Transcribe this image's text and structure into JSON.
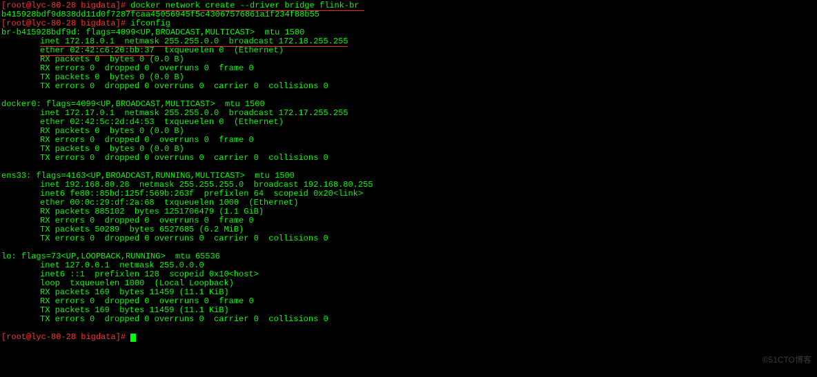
{
  "prompt1": {
    "user_host": "[root@lyc-80-28 bigdata]",
    "hash": "#",
    "cmd": " docker network create --driver bridge flink-br "
  },
  "network_id": "b415928bdf9d838dd11d0f7287fcaa45056945f5c43067576861a1f234f88b55",
  "prompt2": {
    "user_host": "[root@lyc-80-28 bigdata]",
    "hash": "#",
    "cmd": " ifconfig"
  },
  "br": {
    "l1": "br-b415928bdf9d: flags=4099<UP,BROADCAST,MULTICAST>  mtu 1500",
    "l2a": "inet 172.18.0.1  netmask 255.255.0.0  broadcast 172.18.255.255",
    "l3a": "ether 02:42:c6:20:bb:37",
    "l3b": "  txqueuelen 0  (Ethernet)",
    "l4": "RX packets 0  bytes 0 (0.0 B)",
    "l5": "RX errors 0  dropped 0  overruns 0  frame 0",
    "l6": "TX packets 0  bytes 0 (0.0 B)",
    "l7": "TX errors 0  dropped 0 overruns 0  carrier 0  collisions 0"
  },
  "docker0": {
    "l1": "docker0: flags=4099<UP,BROADCAST,MULTICAST>  mtu 1500",
    "l2": "inet 172.17.0.1  netmask 255.255.0.0  broadcast 172.17.255.255",
    "l3": "ether 02:42:5c:2d:d4:53  txqueuelen 0  (Ethernet)",
    "l4": "RX packets 0  bytes 0 (0.0 B)",
    "l5": "RX errors 0  dropped 0  overruns 0  frame 0",
    "l6": "TX packets 0  bytes 0 (0.0 B)",
    "l7": "TX errors 0  dropped 0 overruns 0  carrier 0  collisions 0"
  },
  "ens33": {
    "l1": "ens33: flags=4163<UP,BROADCAST,RUNNING,MULTICAST>  mtu 1500",
    "l2": "inet 192.168.80.28  netmask 255.255.255.0  broadcast 192.168.80.255",
    "l3": "inet6 fe80::85bd:125f:569b:263f  prefixlen 64  scopeid 0x20<link>",
    "l4": "ether 00:0c:29:df:2a:68  txqueuelen 1000  (Ethernet)",
    "l5": "RX packets 885102  bytes 1251706479 (1.1 GiB)",
    "l6": "RX errors 0  dropped 0  overruns 0  frame 0",
    "l7": "TX packets 50289  bytes 6527685 (6.2 MiB)",
    "l8": "TX errors 0  dropped 0 overruns 0  carrier 0  collisions 0"
  },
  "lo": {
    "l1": "lo: flags=73<UP,LOOPBACK,RUNNING>  mtu 65536",
    "l2": "inet 127.0.0.1  netmask 255.0.0.0",
    "l3": "inet6 ::1  prefixlen 128  scopeid 0x10<host>",
    "l4": "loop  txqueuelen 1000  (Local Loopback)",
    "l5": "RX packets 169  bytes 11459 (11.1 KiB)",
    "l6": "RX errors 0  dropped 0  overruns 0  frame 0",
    "l7": "TX packets 169  bytes 11459 (11.1 KiB)",
    "l8": "TX errors 0  dropped 0 overruns 0  carrier 0  collisions 0"
  },
  "prompt3": {
    "user_host": "[root@lyc-80-28 bigdata]",
    "hash": "#",
    "cmd": " "
  },
  "watermark": "©51CTO博客"
}
